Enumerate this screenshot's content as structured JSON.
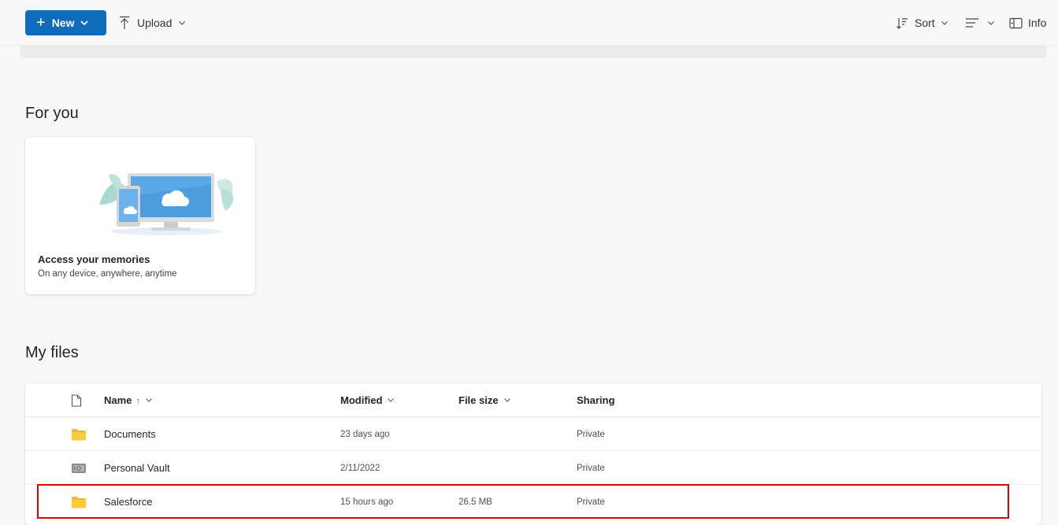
{
  "toolbar": {
    "new_label": "New",
    "upload_label": "Upload",
    "sort_label": "Sort",
    "info_label": "Info"
  },
  "sections": {
    "for_you": "For you",
    "my_files": "My files"
  },
  "card": {
    "title": "Access your memories",
    "subtitle": "On any device, anywhere, anytime"
  },
  "table": {
    "columns": {
      "name": "Name",
      "name_sort_arrow": "↑",
      "modified": "Modified",
      "file_size": "File size",
      "sharing": "Sharing"
    },
    "rows": [
      {
        "icon": "folder-icon",
        "name": "Documents",
        "modified": "23 days ago",
        "size": "",
        "sharing": "Private"
      },
      {
        "icon": "vault-icon",
        "name": "Personal Vault",
        "modified": "2/11/2022",
        "size": "",
        "sharing": "Private"
      },
      {
        "icon": "folder-icon",
        "name": "Salesforce",
        "modified": "15 hours ago",
        "size": "26.5 MB",
        "sharing": "Private"
      }
    ]
  },
  "colors": {
    "accent": "#0f6cbd",
    "highlight": "#e00000",
    "folder": "#ffcb3d"
  }
}
